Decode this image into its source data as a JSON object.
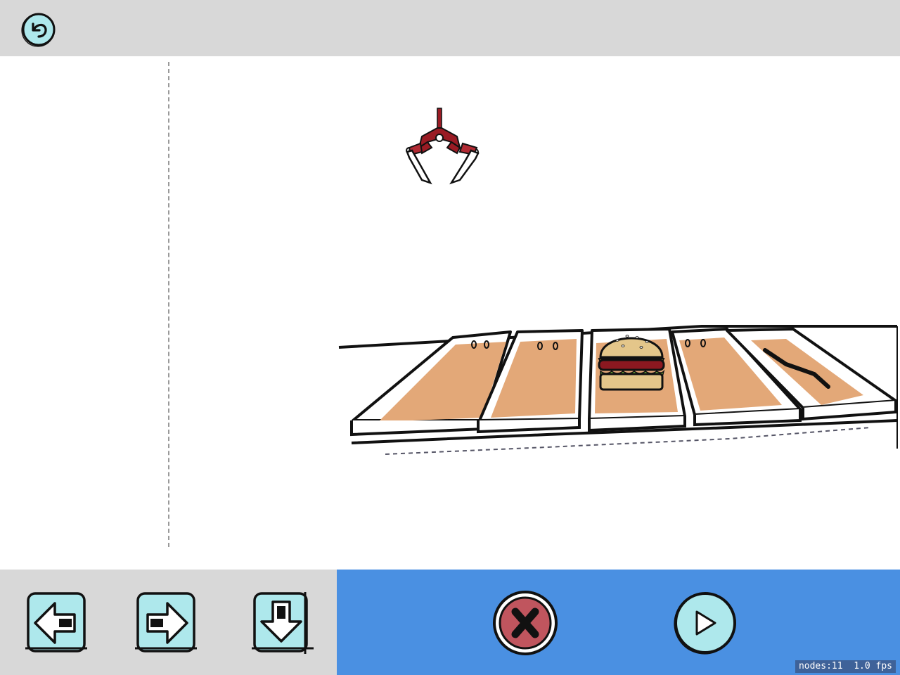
{
  "toolbar": {
    "back_icon": "undo-arrow-icon"
  },
  "scene": {
    "claw_icon": "robot-claw",
    "conveyor_tiles": 5,
    "held_item": "burger"
  },
  "controls": {
    "left_button_icon": "arrow-left-icon",
    "right_button_icon": "arrow-right-icon",
    "down_button_icon": "arrow-down-icon",
    "clear_button_icon": "close-icon",
    "run_button_icon": "play-icon"
  },
  "colors": {
    "toolbar_bg": "#d8d8d8",
    "program_bar_bg": "#4a90e2",
    "button_fill": "#aee8ec",
    "clear_fill": "#c0555e",
    "tile_fill": "#e3a878",
    "claw_red": "#9a1b24"
  },
  "debug": {
    "stats": "nodes:11  1.0 fps"
  }
}
